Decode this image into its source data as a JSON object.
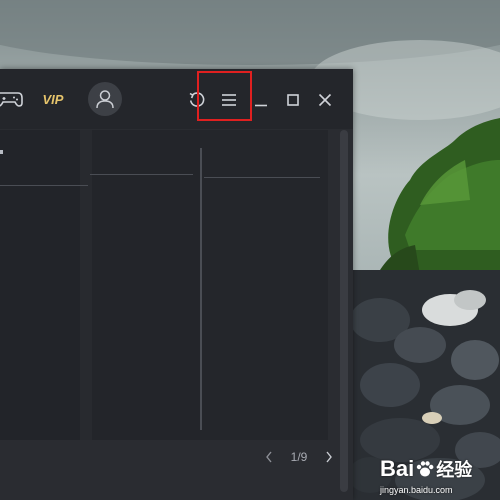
{
  "titlebar": {
    "vip_label": "VIP"
  },
  "pager": {
    "current": "1",
    "separator": "/",
    "total": "9"
  },
  "watermark": {
    "brand": "Bai",
    "brand_suffix": "经验",
    "url": "jingyan.baidu.com"
  },
  "icons": {
    "gamepad": "gamepad-icon",
    "avatar": "user-icon",
    "refresh": "refresh-icon",
    "menu": "menu-icon",
    "minimize": "minimize-icon",
    "maximize": "maximize-icon",
    "close": "close-icon",
    "prev": "chevron-left-icon",
    "next": "chevron-right-icon"
  },
  "colors": {
    "vip": "#e5c36b",
    "highlight_box": "#e02020",
    "window_bg": "#2a2c31",
    "titlebar_bg": "#24262b"
  }
}
